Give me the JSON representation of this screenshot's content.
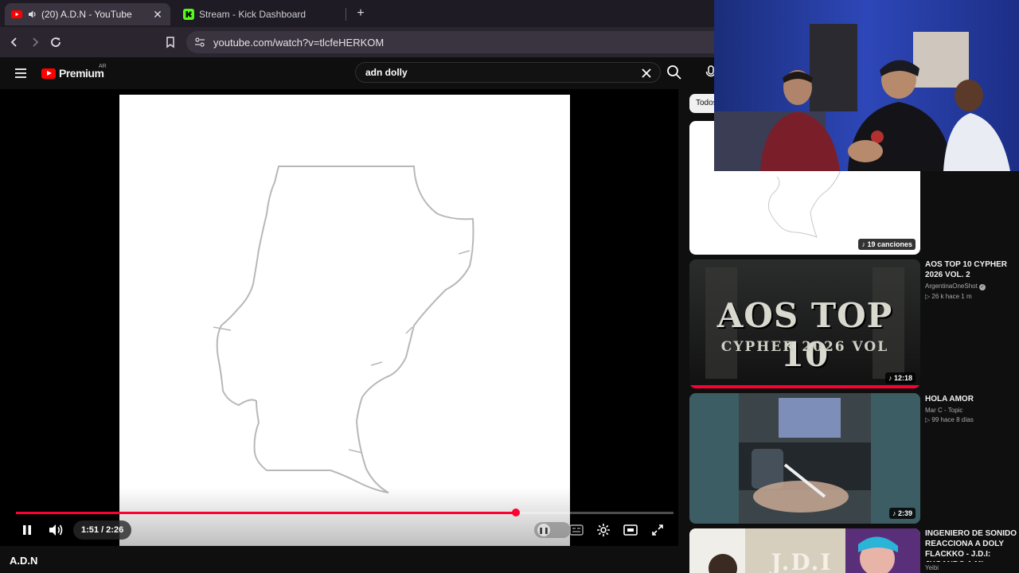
{
  "browser": {
    "tabs": [
      {
        "label": "(20) A.D.N - YouTube",
        "active": true
      },
      {
        "label": "Stream - Kick Dashboard",
        "active": false
      }
    ],
    "url": "youtube.com/watch?v=tlcfeHERKOM"
  },
  "youtube": {
    "logo_text": "Premium",
    "country_code": "AR",
    "search_query": "adn dolly"
  },
  "player": {
    "time_display": "1:51 / 2:26",
    "progress": 0.76,
    "title": "A.D.N"
  },
  "sidebar": {
    "chip_label": "Todos",
    "items": [
      {
        "badge": "♪ 19 canciones"
      },
      {
        "badge": "♪ 12:18",
        "title": "AOS TOP 10 CYPHER 2026 VOL. 2",
        "channel": "ArgentinaOneShot",
        "stats": "▷ 26 k   hace 1 m",
        "thumb_text": "AOS TOP 10",
        "thumb_sub": "CYPHER 2026 VOL"
      },
      {
        "badge": "♪ 2:39",
        "title": "HOLA AMOR",
        "channel": "Mar C - Topic",
        "stats": "▷ 99   hace 8 días"
      },
      {
        "title": "INGENIERO DE SONIDO REACCIONA A DOLY FLACKKO - J.D.I: JUGANDO A MI MANERA | ALBUM COMPLETO",
        "channel": "Yeibi",
        "thumb_text": "J.D.I"
      }
    ]
  },
  "colors": {
    "yt_red": "#ff0033",
    "chrome_tab_bar": "#1f1b24",
    "chrome_toolbar": "#2b2530"
  }
}
